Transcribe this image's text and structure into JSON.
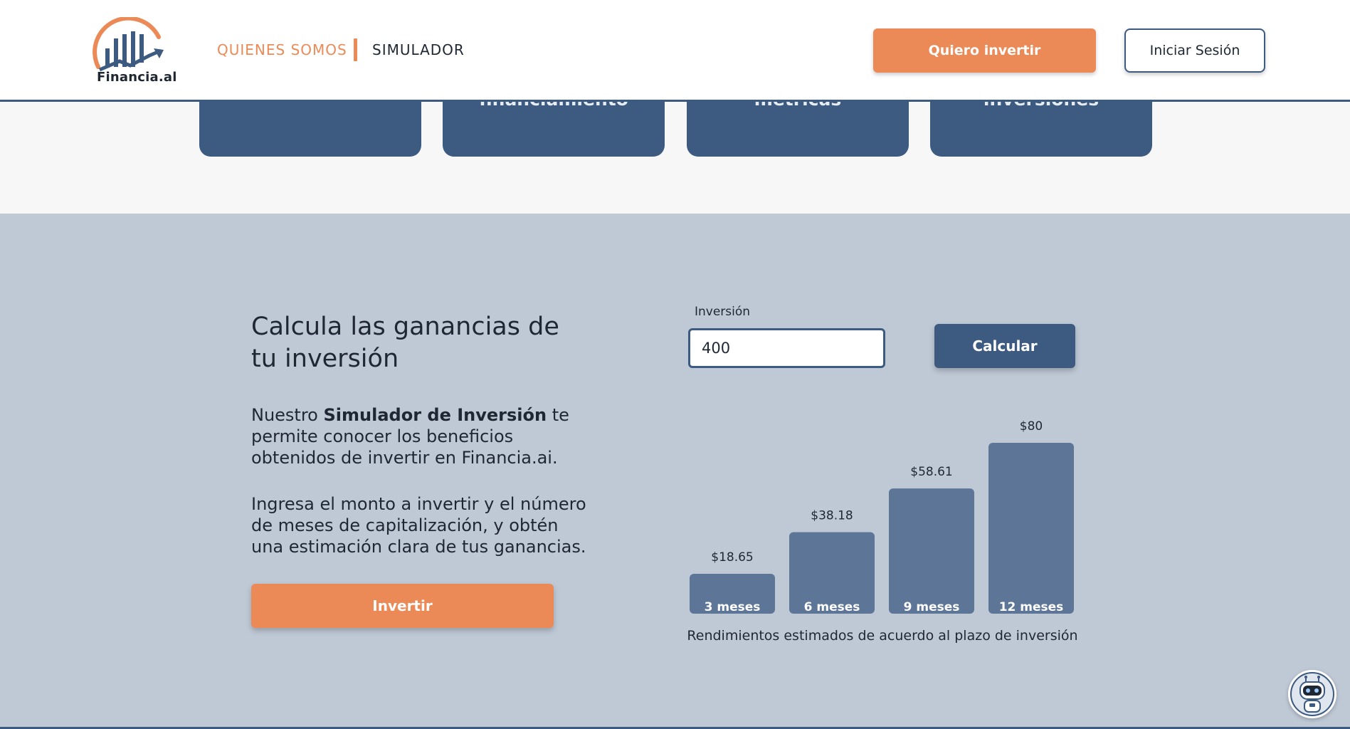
{
  "header": {
    "logo_text": "Financia.al",
    "nav": {
      "quienes_somos": "QUIENES SOMOS",
      "simulador": "SIMULADOR"
    },
    "cta_invest": "Quiero invertir",
    "login": "Iniciar Sesión"
  },
  "cards": [
    {
      "title": ""
    },
    {
      "title": "financiamiento"
    },
    {
      "title": "métricas"
    },
    {
      "title": "inversiones"
    }
  ],
  "simulator": {
    "heading": "Calcula las ganancias de tu inversión",
    "paragraph1_before": "Nuestro ",
    "paragraph1_bold": "Simulador de Inversión",
    "paragraph1_after": " te permite conocer los beneficios obtenidos de invertir en Financia.ai.",
    "paragraph2": "Ingresa el monto a invertir y el número de meses de capitalización, y obtén una estimación clara de tus ganancias.",
    "invest_button": "Invertir",
    "input_label": "Inversión",
    "input_value": "400",
    "calculate_button": "Calcular",
    "chart_caption": "Rendimientos estimados de acuerdo al plazo de inversión"
  },
  "chart_data": {
    "type": "bar",
    "categories": [
      "3 meses",
      "6 meses",
      "9 meses",
      "12 meses"
    ],
    "values": [
      18.65,
      38.18,
      58.61,
      80
    ],
    "value_labels": [
      "$18.65",
      "$38.18",
      "$58.61",
      "$80"
    ],
    "title": "",
    "xlabel": "",
    "ylabel": "",
    "bar_color": "#5d7597"
  },
  "colors": {
    "accent": "#ec8a57",
    "primary": "#3d5a80",
    "section_bg": "#bfc9d6"
  },
  "chatbot": {
    "icon": "robot-icon"
  }
}
